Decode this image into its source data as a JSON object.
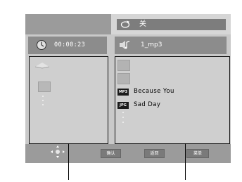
{
  "header": {
    "repeat_label": "关"
  },
  "left_pane": {
    "time": "00:00:23"
  },
  "right_pane": {
    "now_playing": "1_mp3",
    "files": [
      {
        "badge": "MP3",
        "name": "Because You"
      },
      {
        "badge": "JPG",
        "name": "Sad Day"
      }
    ]
  },
  "footer": {
    "ok": "确认",
    "back": "返回",
    "menu": "菜单"
  },
  "icons": {
    "repeat": "repeat-icon",
    "clock": "clock-icon",
    "music": "music-note-icon",
    "folder_up": "folder-up-icon",
    "folder": "folder-icon",
    "nav": "directional-pad-icon"
  }
}
